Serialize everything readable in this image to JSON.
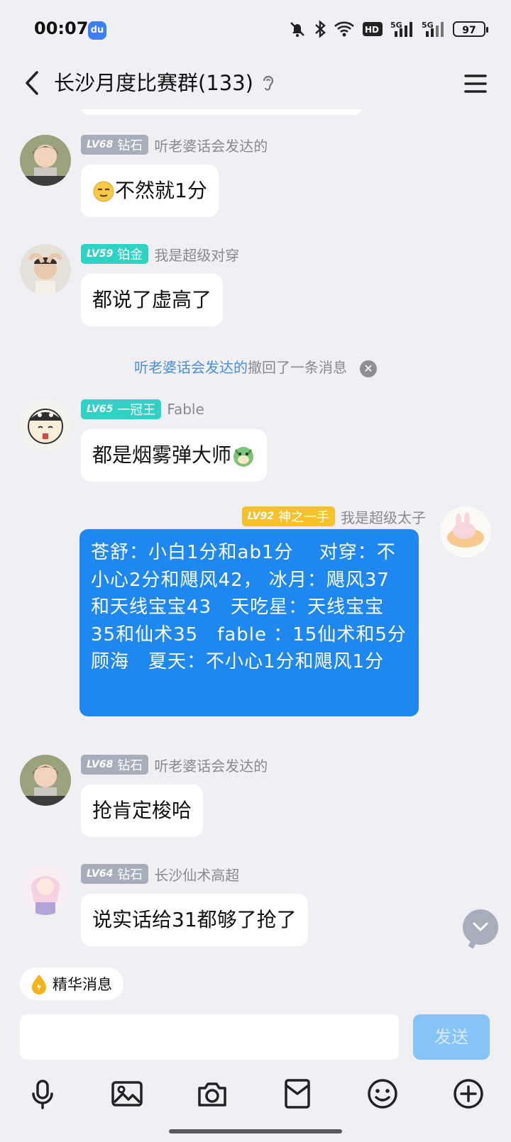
{
  "status": {
    "time": "00:07",
    "battery": "97",
    "net1": "5G",
    "net2": "5G"
  },
  "header": {
    "title": "长沙月度比赛群(133)"
  },
  "messages": [
    {
      "lv": "LV68",
      "rank": "钻石",
      "nick": "听老婆话会发达的",
      "text": "不然就1分"
    },
    {
      "lv": "LV59",
      "rank": "铂金",
      "nick": "我是超级对穿",
      "text": "都说了虚高了"
    },
    {
      "lv": "LV65",
      "rank": "一冠王",
      "nick": "Fable",
      "text": "都是烟雾弹大师"
    },
    {
      "lv": "LV92",
      "rank": "神之一手",
      "nick": "我是超级太子",
      "text": "苍舒：小白1分和ab1分　 对穿：不小心2分和飓风42， 冰月：飓风37和天线宝宝43　天吃星：天线宝宝35和仙术35　fable ：15仙术和5分顾海　夏天：不小心1分和飓风1分"
    },
    {
      "lv": "LV68",
      "rank": "钻石",
      "nick": "听老婆话会发达的",
      "text": "抢肯定梭哈"
    },
    {
      "lv": "LV64",
      "rank": "钻石",
      "nick": "长沙仙术高超",
      "text": "说实话给31都够了抢了"
    }
  ],
  "recall": {
    "who": "听老婆话会发达的",
    "text": "撤回了一条消息"
  },
  "essence_label": "精华消息",
  "send_label": "发送",
  "colors": {
    "accent": "#1e88f0",
    "lv_gray": "#a7adbb",
    "lv_teal": "#2ed3c6",
    "lv_gold": "#f7c02d"
  }
}
